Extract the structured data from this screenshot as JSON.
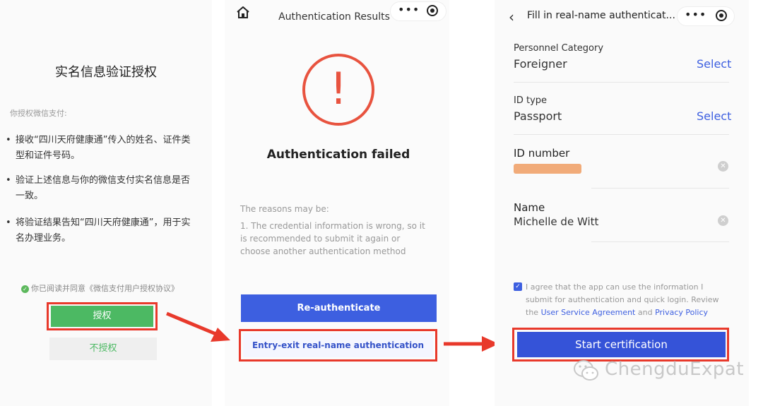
{
  "panel_left": {
    "title": "实名信息验证授权",
    "subtitle": "你授权微信支付:",
    "bullets": [
      "接收“四川天府健康通”传入的姓名、证件类型和证件号码。",
      "验证上述信息与你的微信支付实名信息是否一致。",
      "将验证结果告知“四川天府健康通”，用于实名办理业务。"
    ],
    "agreement": "你已阅读并同意《微信支付用户授权协议》",
    "authorize_button": "授权",
    "decline_button": "不授权"
  },
  "panel_middle": {
    "title": "Authentication Results",
    "status": "Authentication failed",
    "status_mark": "!",
    "reasons_heading": "The reasons may be:",
    "reasons_body": "1. The credential information is wrong, so it is recommended to submit it again or choose another authentication method",
    "reauth_button": "Re-authenticate",
    "entry_exit_button": "Entry-exit real-name authentication"
  },
  "panel_right": {
    "title": "Fill in real-name authenticat...",
    "fields": [
      {
        "label": "Personnel Category",
        "value": "Foreigner",
        "action": "Select"
      },
      {
        "label": "ID type",
        "value": "Passport",
        "action": "Select"
      },
      {
        "label": "ID number",
        "value": ""
      },
      {
        "label": "Name",
        "value": "Michelle de Witt"
      }
    ],
    "agree_prefix": "I agree that the app can use the information I submit for authentication and quick login. Review the ",
    "agree_link_1": "User Service Agreement",
    "agree_and": " and ",
    "agree_link_2": "Privacy Policy",
    "start_button": "Start certification"
  },
  "capsule": {
    "more": "•••"
  },
  "watermark": "ChengduExpat",
  "colors": {
    "accent_blue": "#3d5fe0",
    "wechat_green": "#4cb963",
    "highlight_red": "#e8392b",
    "fail_red": "#e8533f"
  }
}
